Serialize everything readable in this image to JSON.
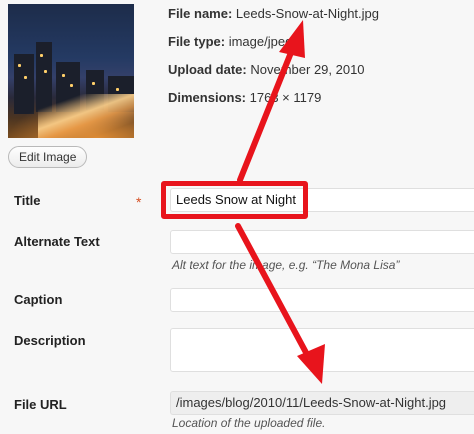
{
  "file_info": {
    "name_label": "File name:",
    "name_value": "Leeds-Snow-at-Night.jpg",
    "type_label": "File type:",
    "type_value": "image/jpeg",
    "date_label": "Upload date:",
    "date_value": "November 29, 2010",
    "dim_label": "Dimensions:",
    "dim_value": "1763 × 1179"
  },
  "edit_button": "Edit Image",
  "fields": {
    "title": {
      "label": "Title",
      "required_mark": "*",
      "value": "Leeds Snow at Night"
    },
    "alt": {
      "label": "Alternate Text",
      "value": "",
      "help": "Alt text for the image, e.g. “The Mona Lisa”"
    },
    "caption": {
      "label": "Caption",
      "value": ""
    },
    "description": {
      "label": "Description",
      "value": ""
    },
    "url": {
      "label": "File URL",
      "value": "/images/blog/2010/11/Leeds-Snow-at-Night.jpg",
      "help": "Location of the uploaded file."
    }
  },
  "colors": {
    "annotation_red": "#e8141c",
    "required_star": "#d54e21"
  },
  "icons": {
    "annotation": "red-arrow-icon"
  }
}
